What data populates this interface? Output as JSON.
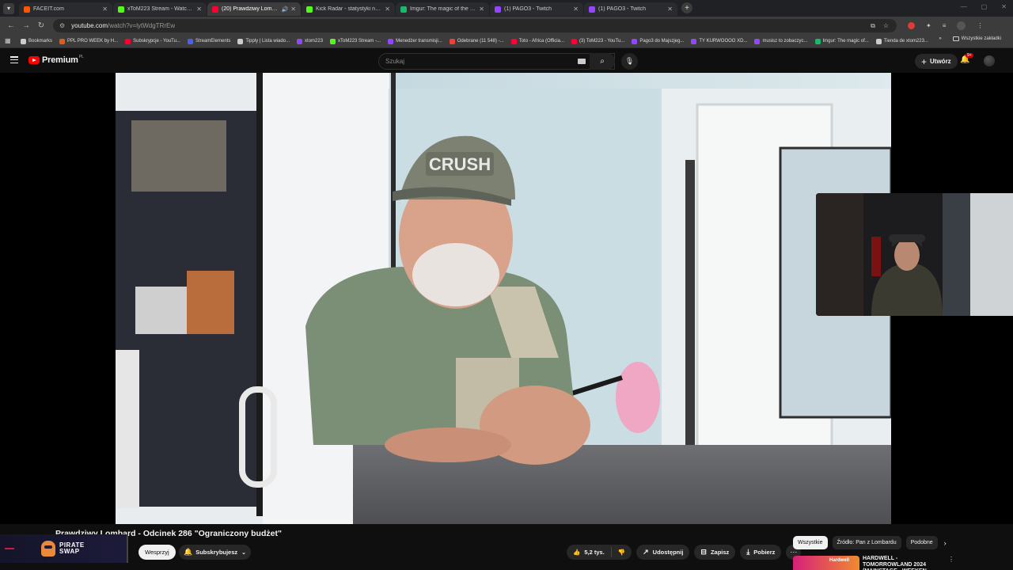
{
  "browser": {
    "tabs": [
      {
        "title": "FACEIT.com",
        "color": "#ff5500",
        "active": false
      },
      {
        "title": "xToM223 Stream - Watch Live o",
        "color": "#53fc18",
        "active": false
      },
      {
        "title": "(20) Prawdziwy Lombard - O",
        "color": "#ff0033",
        "active": true
      },
      {
        "title": "Kick Radar - statystyki na żywo!",
        "color": "#53fc18",
        "active": false
      },
      {
        "title": "Imgur: The magic of the Interne",
        "color": "#1bb76e",
        "active": false
      },
      {
        "title": "(1) PAGO3 - Twitch",
        "color": "#9146ff",
        "active": false
      },
      {
        "title": "(1) PAGO3 - Twitch",
        "color": "#9146ff",
        "active": false
      }
    ],
    "new_tab": "+",
    "url_host": "youtube.com",
    "url_path": "/watch?v=lytWdgTRrEw",
    "bookmarks": [
      {
        "label": "Bookmarks",
        "color": "#cccccc"
      },
      {
        "label": "PPL PRO WEEK by H...",
        "color": "#e55b13"
      },
      {
        "label": "Subskrypcje - YouTu...",
        "color": "#ff0033"
      },
      {
        "label": "StreamElements",
        "color": "#4a5ff2"
      },
      {
        "label": "Tipply | Lista wiado...",
        "color": "#cccccc"
      },
      {
        "label": "xtom223",
        "color": "#9146ff"
      },
      {
        "label": "xToM223 Stream -...",
        "color": "#53fc18"
      },
      {
        "label": "Menedżer transmisji...",
        "color": "#9146ff"
      },
      {
        "label": "Odebrane (11 548) -...",
        "color": "#ea4335"
      },
      {
        "label": "Toto - Africa (Officia...",
        "color": "#ff0033"
      },
      {
        "label": "(3) ToM223 - YouTu...",
        "color": "#ff0033"
      },
      {
        "label": "Pago3 do Majszjeg...",
        "color": "#9146ff"
      },
      {
        "label": "TY KURWOOOO XD...",
        "color": "#9146ff"
      },
      {
        "label": "musisz to zobaczyc...",
        "color": "#9146ff"
      },
      {
        "label": "Imgur: The magic of...",
        "color": "#1bb76e"
      },
      {
        "label": "Tienda de xtom223...",
        "color": "#cccccc"
      }
    ],
    "bookmarks_more": "»",
    "all_bookmarks": "Wszystkie zakładki"
  },
  "youtube": {
    "logo": "Premium",
    "logo_country": "PL",
    "search_placeholder": "Szukaj",
    "create_label": "Utwórz",
    "notif_badge": "9+",
    "video_title": "Prawdziwy Lombard - Odcinek 286 \"Ograniczony budżet\"",
    "channel_brand_line1": "PIRATE",
    "channel_brand_line2": "SWAP",
    "support_label": "Wesprzyj",
    "subscribed_label": "Subskrybujesz",
    "likes": "5,2 tys.",
    "share_label": "Udostępnij",
    "save_label": "Zapisz",
    "download_label": "Pobierz",
    "chips": [
      "Wszystkie",
      "Źródło: Pan z Lombardu",
      "Podobne"
    ],
    "rec_title": "HARDWELL - TOMORROWLAND 2024 (MAINSTAGE - WEEKEN",
    "rec_thumb_label": "Hardwell"
  }
}
